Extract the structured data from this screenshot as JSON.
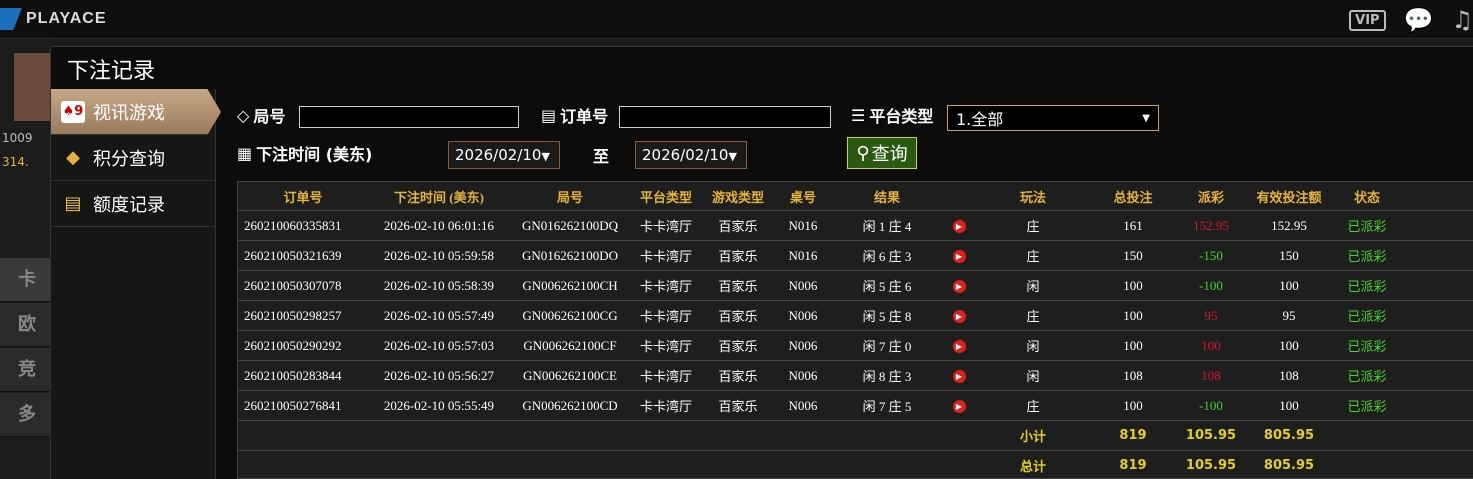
{
  "top": {
    "logo_text": "PLAYACE",
    "vip_label": "VIP"
  },
  "background": {
    "num1": "1009",
    "num2": "314.",
    "row1": "卡",
    "row2": "欧",
    "row3": "竞",
    "row4": "多"
  },
  "modal": {
    "title": "下注记录"
  },
  "sidebar": [
    {
      "label": "视讯游戏",
      "icon": "playing-cards-icon",
      "active": true
    },
    {
      "label": "积分查询",
      "icon": "gem-icon",
      "active": false
    },
    {
      "label": "额度记录",
      "icon": "document-icon",
      "active": false
    }
  ],
  "filters": {
    "round_label": "局号",
    "round_value": "",
    "order_label": "订单号",
    "order_value": "",
    "platform_label": "平台类型",
    "platform_value": "1.全部",
    "time_label": "下注时间 (美东)",
    "date_from": "2026/02/10",
    "to_label": "至",
    "date_to": "2026/02/10",
    "query_label": "查询"
  },
  "table": {
    "headers": [
      "订单号",
      "下注时间 (美东)",
      "局号",
      "平台类型",
      "游戏类型",
      "桌号",
      "结果",
      "",
      "玩法",
      "总投注",
      "派彩",
      "有效投注额",
      "状态"
    ],
    "rows": [
      [
        "260210060335831",
        "2026-02-10 06:01:16",
        "GN016262100DQ",
        "卡卡湾厅",
        "百家乐",
        "N016",
        "闲 1 庄 4",
        "",
        "庄",
        "161",
        "152.95",
        "152.95",
        "已派彩"
      ],
      [
        "260210050321639",
        "2026-02-10 05:59:58",
        "GN016262100DO",
        "卡卡湾厅",
        "百家乐",
        "N016",
        "闲 6 庄 3",
        "",
        "庄",
        "150",
        "-150",
        "150",
        "已派彩"
      ],
      [
        "260210050307078",
        "2026-02-10 05:58:39",
        "GN006262100CH",
        "卡卡湾厅",
        "百家乐",
        "N006",
        "闲 5 庄 6",
        "",
        "闲",
        "100",
        "-100",
        "100",
        "已派彩"
      ],
      [
        "260210050298257",
        "2026-02-10 05:57:49",
        "GN006262100CG",
        "卡卡湾厅",
        "百家乐",
        "N006",
        "闲 5 庄 8",
        "",
        "庄",
        "100",
        "95",
        "95",
        "已派彩"
      ],
      [
        "260210050290292",
        "2026-02-10 05:57:03",
        "GN006262100CF",
        "卡卡湾厅",
        "百家乐",
        "N006",
        "闲 7 庄 0",
        "",
        "闲",
        "100",
        "100",
        "100",
        "已派彩"
      ],
      [
        "260210050283844",
        "2026-02-10 05:56:27",
        "GN006262100CE",
        "卡卡湾厅",
        "百家乐",
        "N006",
        "闲 8 庄 3",
        "",
        "闲",
        "108",
        "108",
        "108",
        "已派彩"
      ],
      [
        "260210050276841",
        "2026-02-10 05:55:49",
        "GN006262100CD",
        "卡卡湾厅",
        "百家乐",
        "N006",
        "闲 7 庄 5",
        "",
        "庄",
        "100",
        "-100",
        "100",
        "已派彩"
      ]
    ],
    "payout_colors": [
      "neg",
      "pos",
      "pos",
      "neg",
      "neg",
      "neg",
      "pos"
    ],
    "subtotal": {
      "label": "小计",
      "total_bet": "819",
      "payout": "105.95",
      "valid_bet": "805.95"
    },
    "total": {
      "label": "总计",
      "total_bet": "819",
      "payout": "105.95",
      "valid_bet": "805.95"
    }
  },
  "colors": {
    "accent": "#e4b43a",
    "positive": "#4ad42a",
    "negative": "#d01a2a",
    "sum": "#e4d020"
  }
}
